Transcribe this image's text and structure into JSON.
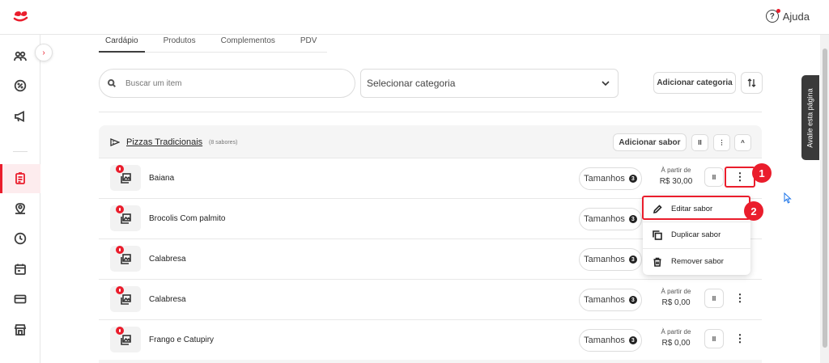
{
  "header": {
    "help_label": "Ajuda"
  },
  "sidebar": {
    "items": [
      {
        "icon": "users-icon"
      },
      {
        "icon": "discount-icon"
      },
      {
        "icon": "megaphone-icon"
      },
      {
        "icon": "menu-list-icon",
        "active": true
      },
      {
        "icon": "map-pin-icon"
      },
      {
        "icon": "clock-icon"
      },
      {
        "icon": "calendar-icon"
      },
      {
        "icon": "card-icon"
      },
      {
        "icon": "store-icon"
      }
    ]
  },
  "tabs": [
    "Cardápio",
    "Produtos",
    "Complementos",
    "PDV"
  ],
  "search": {
    "placeholder": "Buscar um item"
  },
  "category_select": {
    "placeholder": "Selecionar categoria"
  },
  "toolbar": {
    "add_category": "Adicionar categoria"
  },
  "category": {
    "title": "Pizzas Tradicionais",
    "count": "(8 sabores)",
    "add_flavor": "Adicionar sabor",
    "items": [
      {
        "name": "Baiana",
        "sizes_label": "Tamanhos",
        "sizes_count": "3",
        "price_label": "À partir de",
        "price": "R$ 30,00",
        "price_visible": true
      },
      {
        "name": "Brocolis Com palmito",
        "sizes_label": "Tamanhos",
        "sizes_count": "3",
        "price_label": "",
        "price": "",
        "price_visible": false
      },
      {
        "name": "Calabresa",
        "sizes_label": "Tamanhos",
        "sizes_count": "3",
        "price_label": "",
        "price": "",
        "price_visible": false
      },
      {
        "name": "Calabresa",
        "sizes_label": "Tamanhos",
        "sizes_count": "3",
        "price_label": "À partir de",
        "price": "R$ 0,00",
        "price_visible": true
      },
      {
        "name": "Frango e Catupiry",
        "sizes_label": "Tamanhos",
        "sizes_count": "3",
        "price_label": "À partir de",
        "price": "R$ 0,00",
        "price_visible": true
      }
    ]
  },
  "context_menu": {
    "items": [
      {
        "label": "Editar sabor",
        "icon": "pencil-icon"
      },
      {
        "label": "Duplicar sabor",
        "icon": "copy-icon"
      },
      {
        "label": "Remover sabor",
        "icon": "trash-icon"
      }
    ]
  },
  "annotations": {
    "step1": "1",
    "step2": "2"
  },
  "feedback_tab": {
    "label": "Avalie esta página"
  },
  "colors": {
    "brand": "#ea1d2c",
    "text": "#3e3e3e"
  }
}
